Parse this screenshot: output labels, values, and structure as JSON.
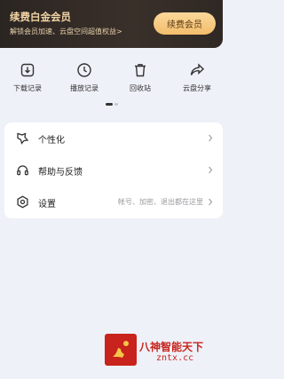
{
  "vip": {
    "title": "续费白金会员",
    "subtitle": "解锁会员加速、云盘空间超值权益>",
    "button_label": "续费会员"
  },
  "shortcuts": [
    {
      "label": "下载记录",
      "icon": "download-record-icon"
    },
    {
      "label": "播放记录",
      "icon": "clock-icon"
    },
    {
      "label": "回收站",
      "icon": "trash-icon"
    },
    {
      "label": "云盘分享",
      "icon": "share-icon"
    }
  ],
  "menu": {
    "personalize": {
      "label": "个性化",
      "icon": "personalize-icon"
    },
    "help": {
      "label": "帮助与反馈",
      "icon": "headset-icon"
    },
    "settings": {
      "label": "设置",
      "hint": "帐号、加密、退出都在这里",
      "icon": "settings-icon"
    }
  },
  "watermark": {
    "line1": "八神智能天下",
    "line2": "zntx.cc"
  },
  "colors": {
    "banner_bg": "#2b2522",
    "banner_gold": "#f1d3a3",
    "button_gold": "#f3bd6c",
    "page_bg": "#eff1f8"
  }
}
